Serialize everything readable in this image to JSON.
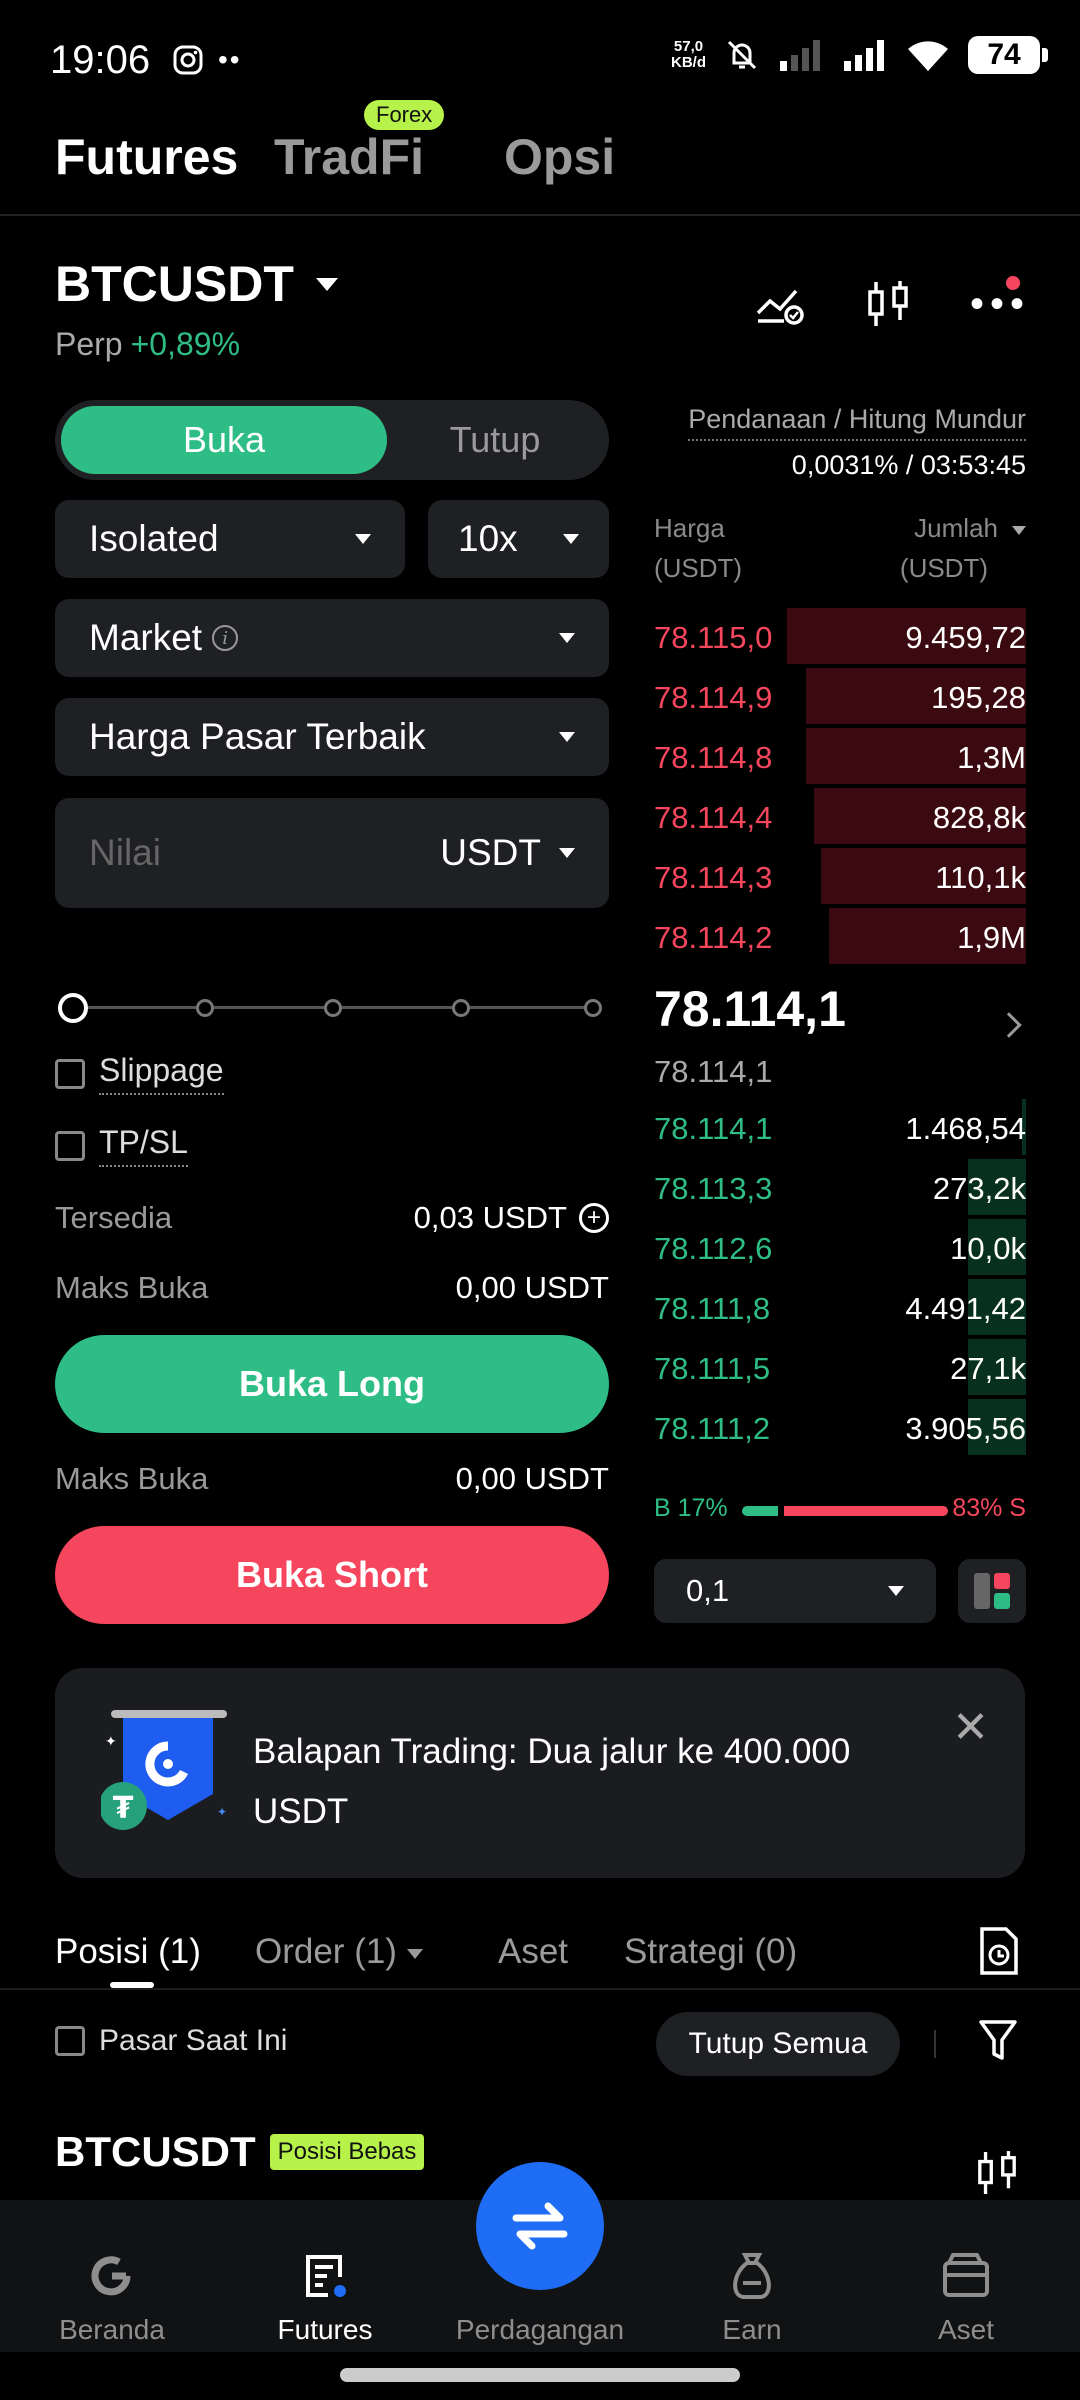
{
  "status": {
    "time": "19:06",
    "net_speed_top": "57,0",
    "net_speed_bottom": "KB/d",
    "battery": "74"
  },
  "top_tabs": [
    {
      "label": "Futures"
    },
    {
      "label": "TradFi"
    },
    {
      "label": "Opsi"
    }
  ],
  "forex_badge": "Forex",
  "pair": {
    "symbol": "BTCUSDT",
    "type": "Perp",
    "change": "+0,89%"
  },
  "form": {
    "open_label": "Buka",
    "close_label": "Tutup",
    "margin_mode": "Isolated",
    "leverage": "10x",
    "order_type": "Market",
    "price_mode": "Harga Pasar Terbaik",
    "amount_placeholder": "Nilai",
    "amount_unit": "USDT",
    "slippage_label": "Slippage",
    "tpsl_label": "TP/SL",
    "available_label": "Tersedia",
    "available_value": "0,03 USDT",
    "max_open_label": "Maks Buka",
    "max_open_long": "0,00 USDT",
    "max_open_short": "0,00 USDT",
    "long_button": "Buka Long",
    "short_button": "Buka Short"
  },
  "orderbook": {
    "funding_label": "Pendanaan / Hitung Mundur",
    "funding_value": "0,0031% / 03:53:45",
    "price_header_1": "Harga",
    "price_header_2": "(USDT)",
    "qty_header_1": "Jumlah",
    "qty_header_2": "(USDT)",
    "asks": [
      {
        "price": "78.115,0",
        "qty": "9.459,72",
        "depth": 0.62
      },
      {
        "price": "78.114,9",
        "qty": "195,28",
        "depth": 0.57
      },
      {
        "price": "78.114,8",
        "qty": "1,3M",
        "depth": 0.57
      },
      {
        "price": "78.114,4",
        "qty": "828,8k",
        "depth": 0.55
      },
      {
        "price": "78.114,3",
        "qty": "110,1k",
        "depth": 0.53
      },
      {
        "price": "78.114,2",
        "qty": "1,9M",
        "depth": 0.51
      }
    ],
    "last_price": "78.114,1",
    "mark_price": "78.114,1",
    "bids": [
      {
        "price": "78.114,1",
        "qty": "1.468,54",
        "depth": 0.01
      },
      {
        "price": "78.113,3",
        "qty": "273,2k",
        "depth": 0.15
      },
      {
        "price": "78.112,6",
        "qty": "10,0k",
        "depth": 0.15
      },
      {
        "price": "78.111,8",
        "qty": "4.491,42",
        "depth": 0.15
      },
      {
        "price": "78.111,5",
        "qty": "27,1k",
        "depth": 0.15
      },
      {
        "price": "78.111,2",
        "qty": "3.905,56",
        "depth": 0.15
      }
    ],
    "buy_ratio": "B 17%",
    "sell_ratio": "83% S",
    "depth_step": "0,1"
  },
  "banner": {
    "text": "Balapan Trading: Dua jalur ke 400.000 USDT"
  },
  "position_tabs": [
    {
      "label": "Posisi (1)"
    },
    {
      "label": "Order (1)"
    },
    {
      "label": "Aset"
    },
    {
      "label": "Strategi (0)"
    }
  ],
  "positions": {
    "current_market_label": "Pasar Saat Ini",
    "close_all_label": "Tutup Semua",
    "symbol": "BTCUSDT",
    "badge": "Posisi Bebas"
  },
  "nav": [
    {
      "label": "Beranda"
    },
    {
      "label": "Futures"
    },
    {
      "label": "Perdagangan"
    },
    {
      "label": "Earn"
    },
    {
      "label": "Aset"
    }
  ],
  "colors": {
    "green": "#2ebd85",
    "red": "#f6465d",
    "blue": "#1f6cf5",
    "badge": "#b6f24a"
  }
}
